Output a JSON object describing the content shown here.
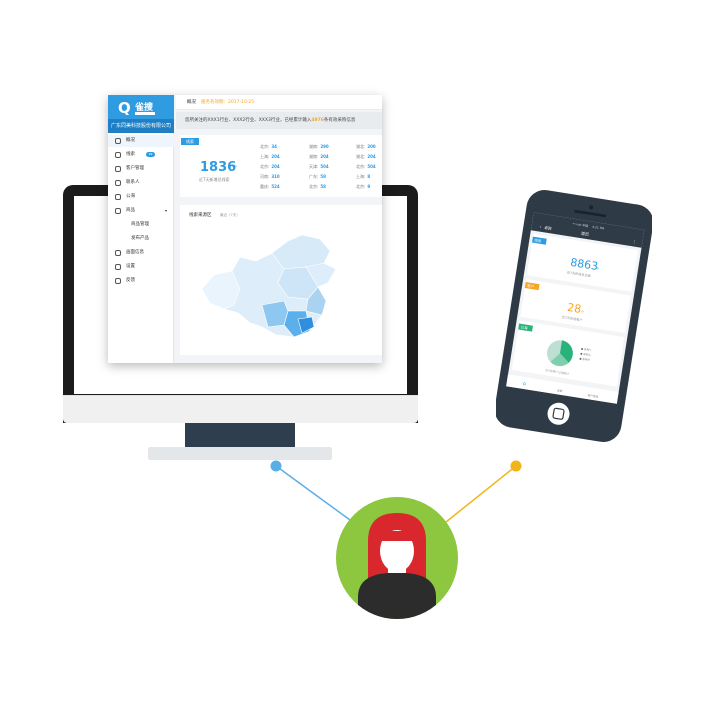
{
  "sidebar": {
    "logo_glyph": "Q",
    "logo_text": "雀搜",
    "company": "广东同美科技股份有限公司",
    "items": [
      {
        "label": "概况",
        "icon": "user-icon"
      },
      {
        "label": "线索",
        "icon": "cart-icon",
        "badge": "99"
      },
      {
        "label": "客户管理",
        "icon": "person-icon"
      },
      {
        "label": "联系人",
        "icon": "contact-icon"
      },
      {
        "label": "公海",
        "icon": "group-icon"
      },
      {
        "label": "商品",
        "icon": "box-icon",
        "caret": "▾"
      },
      {
        "label": "商品管理",
        "icon": ""
      },
      {
        "label": "发布产品",
        "icon": ""
      },
      {
        "label": "画面信息",
        "icon": "globe-icon"
      },
      {
        "label": "设置",
        "icon": "gear-icon"
      },
      {
        "label": "反馈",
        "icon": "feedback-icon"
      }
    ]
  },
  "topbar": {
    "title": "概况",
    "expiry": "服务有效期：2017-10-25"
  },
  "notice": {
    "prefix": "您所关注的XXX1行业、XXX2行业、XXX3行业，已经累计输入",
    "highlight": "4976",
    "suffix": "条有效采购信息"
  },
  "stats": {
    "tag": "线索",
    "total": "1836",
    "unit": "个",
    "total_label": "近7天新增总线索",
    "grid": [
      [
        "北京:",
        "34",
        "湖南:",
        "290",
        "湖北:",
        "200"
      ],
      [
        "上海:",
        "204",
        "湖南:",
        "204",
        "湖北:",
        "204"
      ],
      [
        "北京:",
        "204",
        "天津:",
        "504",
        "北京:",
        "504"
      ],
      [
        "河南:",
        "310",
        "广东:",
        "58",
        "上海:",
        "8"
      ],
      [
        "重庆:",
        "524",
        "北京:",
        "58",
        "北京:",
        "9"
      ]
    ]
  },
  "map": {
    "title": "线索来源区",
    "subtitle": "最近（7天）"
  },
  "phone": {
    "status_carrier": "•••oo 中国",
    "status_time": "4:21 PM",
    "back_label": "返回",
    "title": "首页",
    "cards": [
      {
        "tag": "线索",
        "value": "8863",
        "unit": "个",
        "label": "近7天新增总线索",
        "color": "#2f9be0"
      },
      {
        "tag": "客户",
        "value": "28",
        "unit": "个",
        "label": "近7天新增客户",
        "color": "#f5a623"
      },
      {
        "tag": "公海",
        "value": "",
        "unit": "",
        "label": "近7天客户公海统计",
        "color": "#2ab27b"
      }
    ],
    "legend": [
      "● 系列一",
      "● 系列二",
      "● 系列三"
    ],
    "tabs": [
      "",
      "线索",
      "客户管理"
    ]
  },
  "colors": {
    "accent": "#2f9be0",
    "orange": "#f5a623",
    "green": "#8dc63f",
    "connector_left": "#5aaee8",
    "connector_right": "#f2b418"
  }
}
